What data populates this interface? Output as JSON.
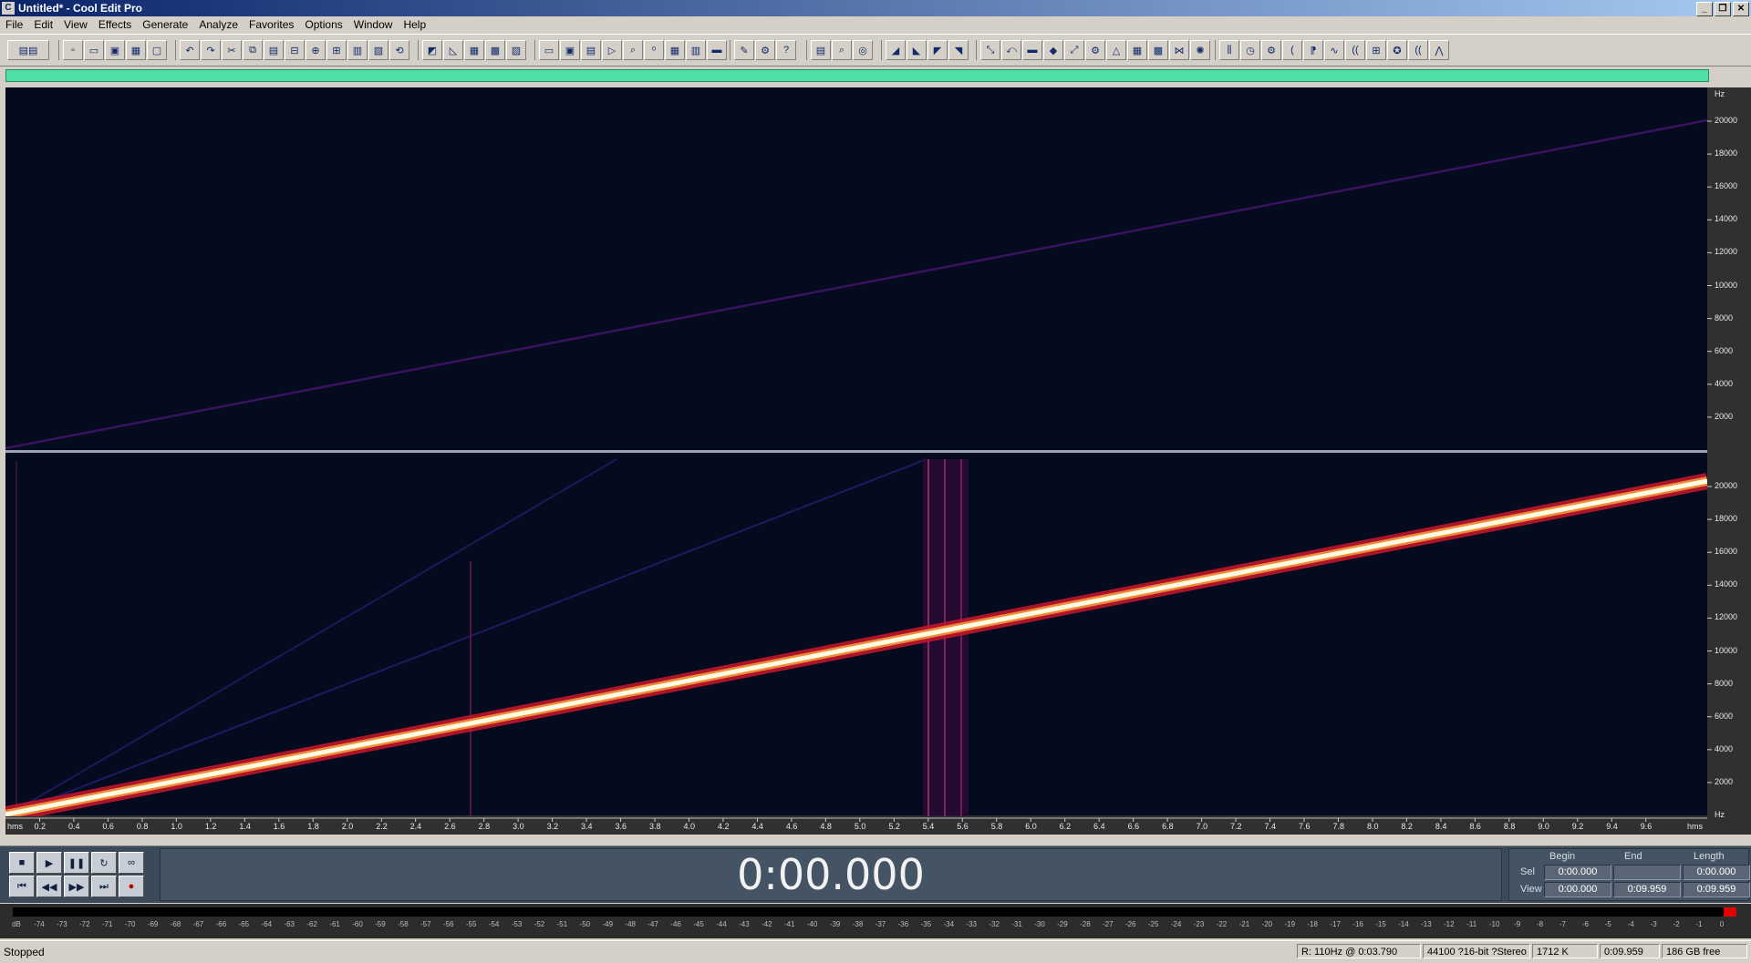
{
  "window": {
    "title": "Untitled* - Cool Edit Pro",
    "buttons": [
      "0",
      "1",
      "r"
    ]
  },
  "menu": [
    "File",
    "Edit",
    "View",
    "Effects",
    "Generate",
    "Analyze",
    "Favorites",
    "Options",
    "Window",
    "Help"
  ],
  "spectrogram": {
    "freq_unit": "Hz",
    "freq_ticks": [
      "20000",
      "18000",
      "16000",
      "14000",
      "12000",
      "10000",
      "8000",
      "6000",
      "4000",
      "2000"
    ],
    "time_unit": "hms",
    "time_ticks": [
      "0.2",
      "0.4",
      "0.6",
      "0.8",
      "1.0",
      "1.2",
      "1.4",
      "1.6",
      "1.8",
      "2.0",
      "2.2",
      "2.4",
      "2.6",
      "2.8",
      "3.0",
      "3.2",
      "3.4",
      "3.6",
      "3.8",
      "4.0",
      "4.2",
      "4.4",
      "4.6",
      "4.8",
      "5.0",
      "5.2",
      "5.4",
      "5.6",
      "5.8",
      "6.0",
      "6.2",
      "6.4",
      "6.6",
      "6.8",
      "7.0",
      "7.2",
      "7.4",
      "7.6",
      "7.8",
      "8.0",
      "8.2",
      "8.4",
      "8.6",
      "8.8",
      "9.0",
      "9.2",
      "9.4",
      "9.6"
    ],
    "colors": {
      "background": "#050b1e",
      "top_sweep": "#3a1260",
      "bottom_sweep_core": "#fffbe0",
      "bottom_sweep_glow": "#c8162c"
    }
  },
  "transport": {
    "time": "0:00.000",
    "glyphs": [
      "■",
      "▶",
      "❚❚",
      "↻",
      "∞",
      "⏮",
      "◀◀",
      "▶▶",
      "⏭",
      "●"
    ]
  },
  "selection": {
    "headers": {
      "begin": "Begin",
      "end": "End",
      "length": "Length"
    },
    "rows": {
      "sel": "Sel",
      "view": "View"
    },
    "sel": {
      "begin": "0:00.000",
      "end": "",
      "length": "0:00.000"
    },
    "view": {
      "begin": "0:00.000",
      "end": "0:09.959",
      "length": "0:09.959"
    }
  },
  "level_meter": {
    "labels": [
      "dB",
      "-74",
      "-73",
      "-72",
      "-71",
      "-70",
      "-69",
      "-68",
      "-67",
      "-66",
      "-65",
      "-64",
      "-63",
      "-62",
      "-61",
      "-60",
      "-59",
      "-58",
      "-57",
      "-56",
      "-55",
      "-54",
      "-53",
      "-52",
      "-51",
      "-50",
      "-49",
      "-48",
      "-47",
      "-46",
      "-45",
      "-44",
      "-43",
      "-42",
      "-41",
      "-40",
      "-39",
      "-38",
      "-37",
      "-36",
      "-35",
      "-34",
      "-33",
      "-32",
      "-31",
      "-30",
      "-29",
      "-28",
      "-27",
      "-26",
      "-25",
      "-24",
      "-23",
      "-22",
      "-21",
      "-20",
      "-19",
      "-18",
      "-17",
      "-16",
      "-15",
      "-14",
      "-13",
      "-12",
      "-11",
      "-10",
      "-9",
      "-8",
      "-7",
      "-6",
      "-5",
      "-4",
      "-3",
      "-2",
      "-1",
      "0"
    ]
  },
  "status": {
    "state": "Stopped",
    "cursor": "R: 110Hz @   0:03.790",
    "format": "44100 ?16-bit ?Stereo",
    "size": "1712 K",
    "duration": "0:09.959",
    "free": "186 GB free"
  }
}
